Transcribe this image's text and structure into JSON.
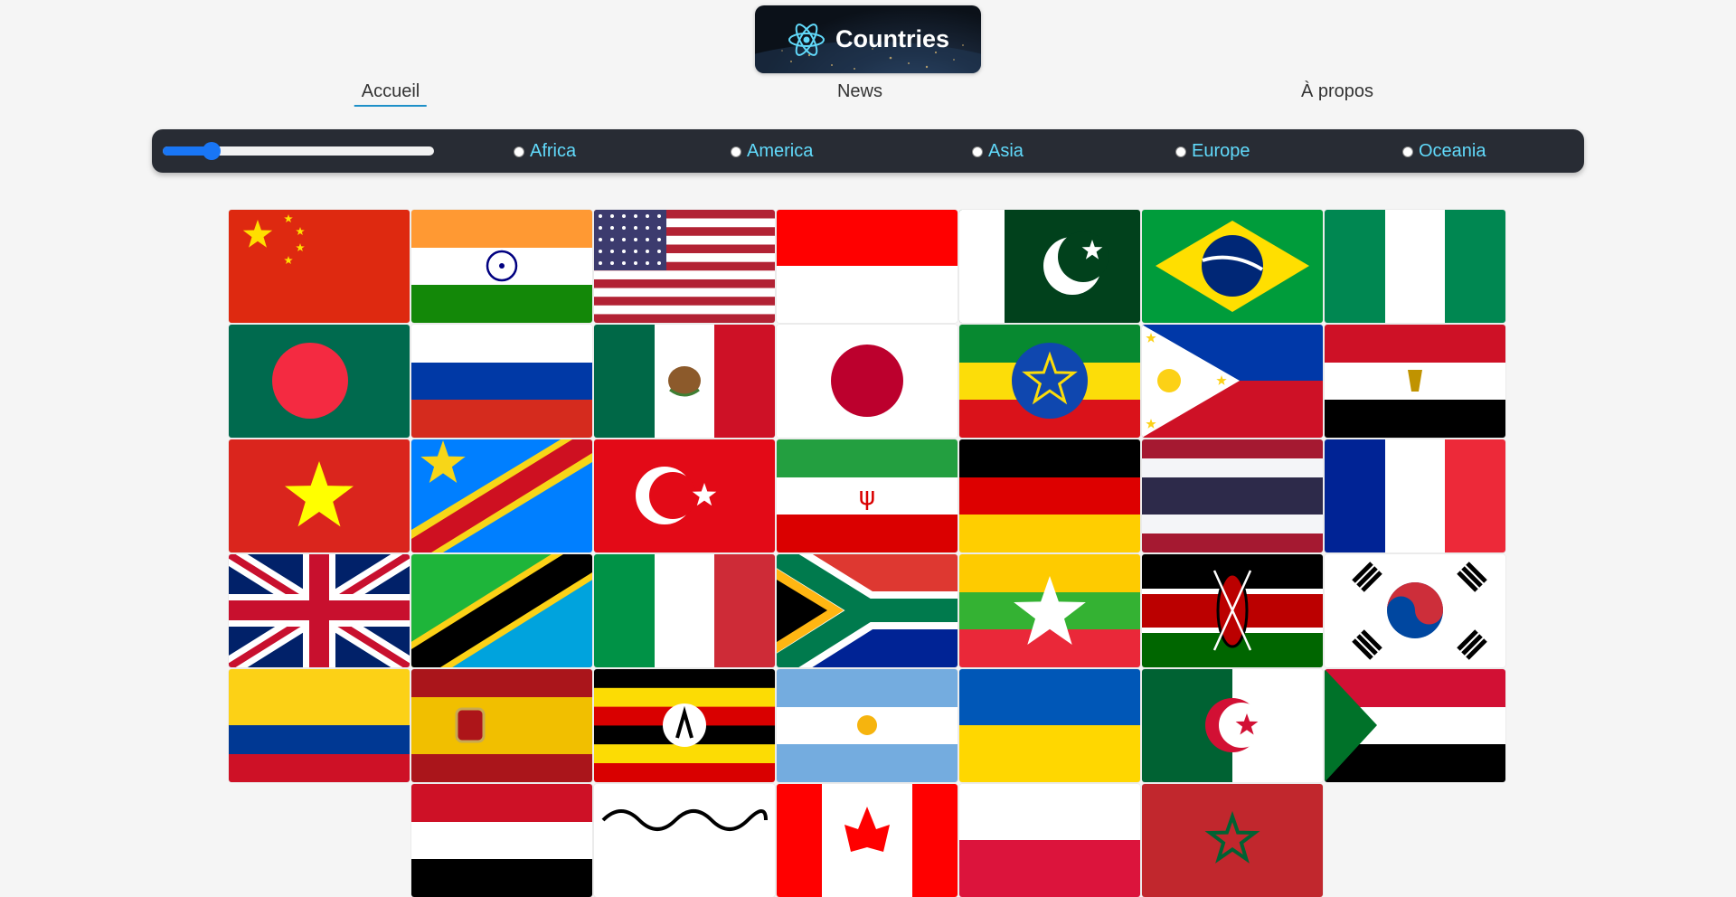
{
  "header": {
    "title": "Countries"
  },
  "nav": {
    "home": "Accueil",
    "news": "News",
    "about": "À propos"
  },
  "filters": {
    "slider_fraction": 0.18,
    "regions": [
      "Africa",
      "America",
      "Asia",
      "Europe",
      "Oceania"
    ],
    "region_color": "#61dafb",
    "bar_color": "#282c34",
    "accent": "#1976f5"
  },
  "flags": [
    [
      "china",
      "india",
      "usa",
      "indonesia",
      "pakistan",
      "brazil",
      "nigeria"
    ],
    [
      "bangladesh",
      "russia",
      "mexico",
      "japan",
      "ethiopia",
      "philippines",
      "egypt"
    ],
    [
      "vietnam",
      "dr-congo",
      "turkey",
      "iran",
      "germany",
      "thailand",
      "france"
    ],
    [
      "united-kingdom",
      "tanzania",
      "italy",
      "south-africa",
      "myanmar",
      "kenya",
      "south-korea"
    ],
    [
      "colombia",
      "spain",
      "uganda",
      "argentina",
      "ukraine",
      "algeria",
      "sudan"
    ],
    [
      "",
      "iraq",
      "afghanistan",
      "canada",
      "poland",
      "morocco",
      ""
    ]
  ]
}
